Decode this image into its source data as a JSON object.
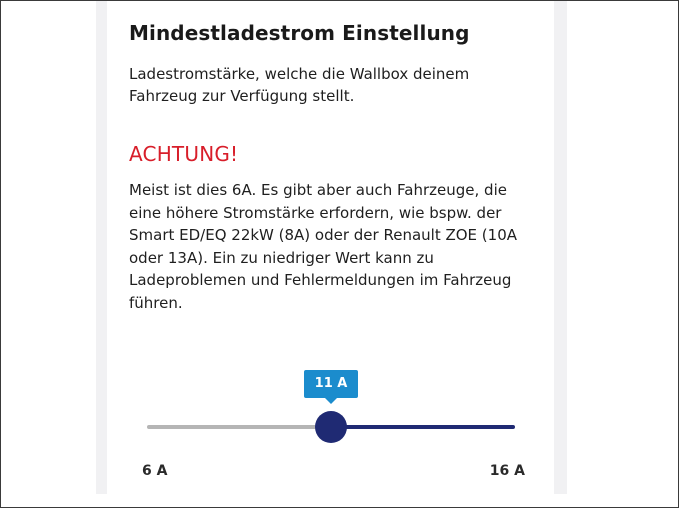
{
  "section": {
    "title": "Mindestladestrom Einstellung",
    "description": "Ladestromstärke, welche die Wallbox deinem Fahrzeug zur Verfügung stellt."
  },
  "warning": {
    "title": "ACHTUNG!",
    "text": "Meist ist dies 6A. Es gibt aber auch Fahrzeuge, die eine höhere Stromstärke erfordern, wie bspw. der Smart ED/EQ 22kW (8A) oder der Renault ZOE (10A oder 13A). Ein zu niedriger Wert kann zu Ladeproblemen und Fehlermeldungen im Fahrzeug führen.",
    "color": "#d81e2a"
  },
  "slider": {
    "min": 6,
    "max": 16,
    "value": 11,
    "value_label": "11 A",
    "min_label": "6 A",
    "max_label": "16 A",
    "fill_color": "#1f2a73",
    "rest_color": "#b5b5b5",
    "bubble_color": "#1b8ccd"
  }
}
